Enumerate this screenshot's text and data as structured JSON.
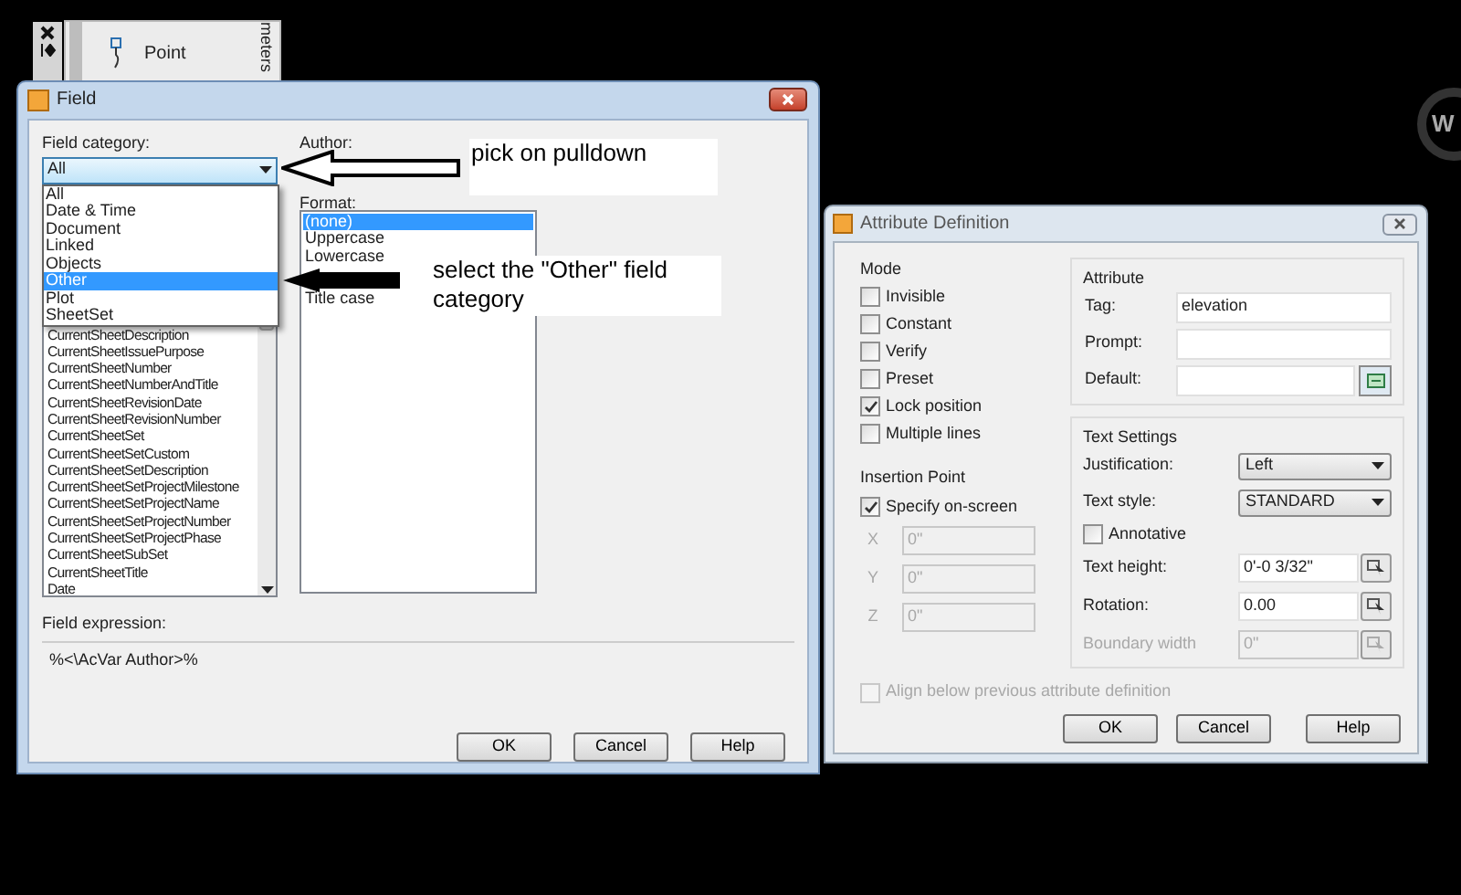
{
  "palette": {
    "item": "Point",
    "tab_label": "meters"
  },
  "field_dialog": {
    "title": "Field",
    "category_label": "Field category:",
    "category_value": "All",
    "category_options": [
      {
        "label": "All",
        "selected": false
      },
      {
        "label": "Date & Time",
        "selected": false
      },
      {
        "label": "Document",
        "selected": false
      },
      {
        "label": "Linked",
        "selected": false
      },
      {
        "label": "Objects",
        "selected": false
      },
      {
        "label": "Other",
        "selected": true
      },
      {
        "label": "Plot",
        "selected": false
      },
      {
        "label": "SheetSet",
        "selected": false
      }
    ],
    "field_names": [
      "CurrentSheetDescription",
      "CurrentSheetIssuePurpose",
      "CurrentSheetNumber",
      "CurrentSheetNumberAndTitle",
      "CurrentSheetRevisionDate",
      "CurrentSheetRevisionNumber",
      "CurrentSheetSet",
      "CurrentSheetSetCustom",
      "CurrentSheetSetDescription",
      "CurrentSheetSetProjectMilestone",
      "CurrentSheetSetProjectName",
      "CurrentSheetSetProjectNumber",
      "CurrentSheetSetProjectPhase",
      "CurrentSheetSubSet",
      "CurrentSheetTitle",
      "Date"
    ],
    "author_label": "Author:",
    "format_label": "Format:",
    "formats": [
      {
        "label": "(none)",
        "selected": true
      },
      {
        "label": "Uppercase",
        "selected": false
      },
      {
        "label": "Lowercase",
        "selected": false
      },
      {
        "label": "Title case",
        "selected": false
      }
    ],
    "expression_label": "Field expression:",
    "expression": "%<\\AcVar Author>%",
    "buttons": [
      "OK",
      "Cancel",
      "Help"
    ]
  },
  "annotations": [
    {
      "text": "pick on pulldown"
    },
    {
      "text": "select the \"Other\" field category"
    }
  ],
  "attribute_dialog": {
    "title": "Attribute Definition",
    "mode_label": "Mode",
    "modes": [
      {
        "label": "Invisible",
        "checked": false
      },
      {
        "label": "Constant",
        "checked": false
      },
      {
        "label": "Verify",
        "checked": false
      },
      {
        "label": "Preset",
        "checked": false
      },
      {
        "label": "Lock position",
        "checked": true
      },
      {
        "label": "Multiple lines",
        "checked": false
      }
    ],
    "insertion_label": "Insertion Point",
    "specify": {
      "label": "Specify on-screen",
      "checked": true
    },
    "coords": [
      {
        "axis": "X",
        "value": "0\"",
        "disabled": true
      },
      {
        "axis": "Y",
        "value": "0\"",
        "disabled": true
      },
      {
        "axis": "Z",
        "value": "0\"",
        "disabled": true
      }
    ],
    "attribute_label": "Attribute",
    "attributes": [
      {
        "label": "Tag:",
        "value": "elevation",
        "picker": false
      },
      {
        "label": "Prompt:",
        "picker": false
      },
      {
        "label": "Default:",
        "picker": true
      }
    ],
    "text_settings_label": "Text Settings",
    "text_settings": [
      {
        "kind": "select",
        "label": "Justification:",
        "value": "Left",
        "disabled": false
      },
      {
        "kind": "select",
        "label": "Text style:",
        "value": "STANDARD",
        "disabled": false
      },
      {
        "kind": "checkbox",
        "label": "Annotative",
        "checked": false,
        "disabled": false
      },
      {
        "kind": "input",
        "label": "Text height:",
        "value": "0'-0 3/32\"",
        "disabled": false
      },
      {
        "kind": "input",
        "label": "Rotation:",
        "value": "0.00",
        "disabled": false
      },
      {
        "kind": "input",
        "label": "Boundary width",
        "value": "0\"",
        "disabled": true
      }
    ],
    "align": {
      "label": "Align below previous attribute definition",
      "checked": false,
      "disabled": true
    },
    "buttons": [
      "OK",
      "Cancel",
      "Help"
    ]
  },
  "viewcube": {
    "label": "W"
  }
}
